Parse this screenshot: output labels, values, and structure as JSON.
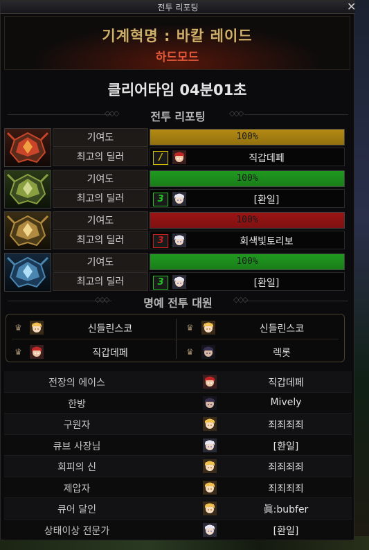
{
  "window": {
    "title": "전투 리포팅",
    "close_glyph": "✕"
  },
  "header": {
    "dungeon": "기계혁명 : 바칼 레이드",
    "mode": "하드모드",
    "clear_time": "클리어타임  04분01초"
  },
  "sections": {
    "report": "전투 리포팅",
    "honor": "명예 전투 대원",
    "deco_left": "◇◇◇",
    "deco_right": "◇◇◇"
  },
  "labels": {
    "contribution": "기여도",
    "top_dealer": "최고의 딜러"
  },
  "bosses": [
    {
      "icon": "fire-dragon-icon",
      "contribution_text": "100%",
      "contribution": 1.0,
      "bar_color": "#b38a12",
      "badge": "/",
      "badge_color": "#d6c000",
      "avatar": "red-cap-avatar",
      "dealer": "직갑데페"
    },
    {
      "icon": "green-dragon-icon",
      "contribution_text": "100%",
      "contribution": 1.0,
      "bar_color": "#1f9a1f",
      "badge": "3",
      "badge_color": "#22c322",
      "avatar": "white-hair-avatar",
      "dealer": "[환일]"
    },
    {
      "icon": "gold-dragon-icon",
      "contribution_text": "100%",
      "contribution": 1.0,
      "bar_color": "#9c1414",
      "badge": "3",
      "badge_color": "#c81e1e",
      "avatar": "white-hair-avatar",
      "dealer": "회색빛토리보"
    },
    {
      "icon": "ice-dragon-icon",
      "contribution_text": "100%",
      "contribution": 1.0,
      "bar_color": "#1f9a1f",
      "badge": "3",
      "badge_color": "#22c322",
      "avatar": "white-hair-avatar",
      "dealer": "[환일]"
    }
  ],
  "honor": [
    {
      "icon": "crown-icon",
      "avatar": "blonde-avatar",
      "name": "신들린스코"
    },
    {
      "icon": "crown-icon",
      "avatar": "blonde-avatar",
      "name": "신들린스코"
    },
    {
      "icon": "crown-icon",
      "avatar": "red-cap-avatar",
      "name": "직갑데페"
    },
    {
      "icon": "crown-icon",
      "avatar": "dark-avatar",
      "name": "렉롯"
    }
  ],
  "awards": [
    {
      "title": "전장의 에이스",
      "avatar": "red-cap-avatar",
      "player": "직갑데페"
    },
    {
      "title": "한방",
      "avatar": "dark-avatar",
      "player": "Mively"
    },
    {
      "title": "구원자",
      "avatar": "blonde-avatar",
      "player": "죄죄죄죄"
    },
    {
      "title": "큐브 사장님",
      "avatar": "white-hair-avatar",
      "player": "[환일]"
    },
    {
      "title": "회피의 신",
      "avatar": "blonde-avatar",
      "player": "죄죄죄죄"
    },
    {
      "title": "제압자",
      "avatar": "blonde-avatar",
      "player": "죄죄죄죄"
    },
    {
      "title": "큐어 달인",
      "avatar": "blonde-avatar",
      "player": "眞:bubfer"
    },
    {
      "title": "상태이상 전문가",
      "avatar": "white-hair-avatar",
      "player": "[환일]"
    }
  ]
}
